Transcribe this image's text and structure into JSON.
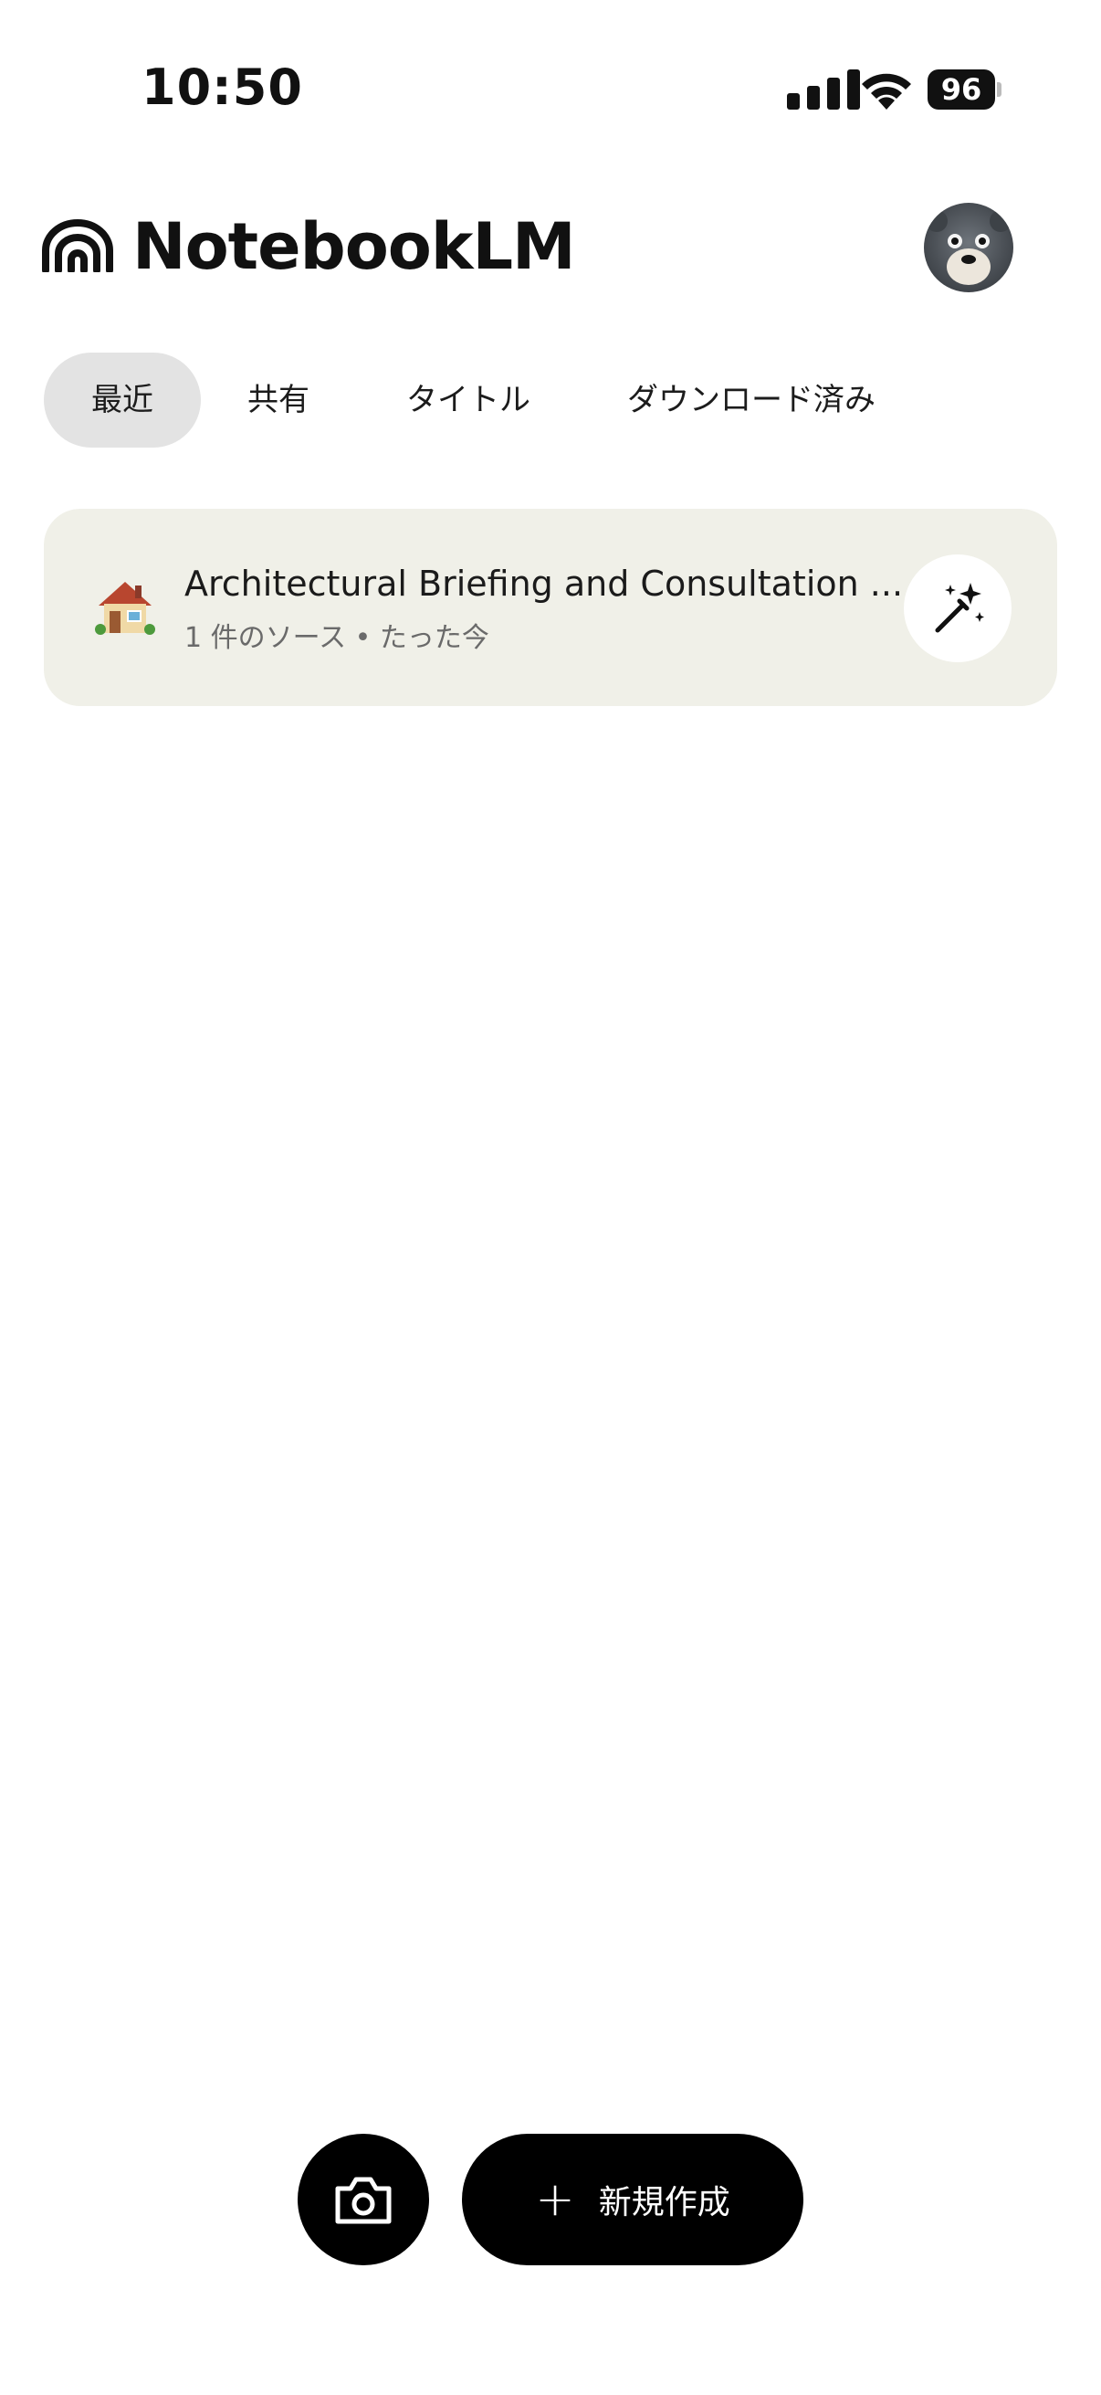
{
  "status_bar": {
    "time": "10:50",
    "battery": "96"
  },
  "header": {
    "title": "NotebookLM"
  },
  "tabs": [
    {
      "label": "最近",
      "selected": true
    },
    {
      "label": "共有",
      "selected": false
    },
    {
      "label": "タイトル",
      "selected": false
    },
    {
      "label": "ダウンロード済み",
      "selected": false
    }
  ],
  "notebooks": [
    {
      "emoji": "🏠",
      "title": "Architectural Briefing and Consultation ...",
      "meta": "1 件のソース • たった今"
    }
  ],
  "actions": {
    "new_label": "新規作成"
  },
  "colors": {
    "selected_tab_bg": "#e3e3e3",
    "card_bg": "#f0f0e8",
    "action_bg": "#000000"
  }
}
